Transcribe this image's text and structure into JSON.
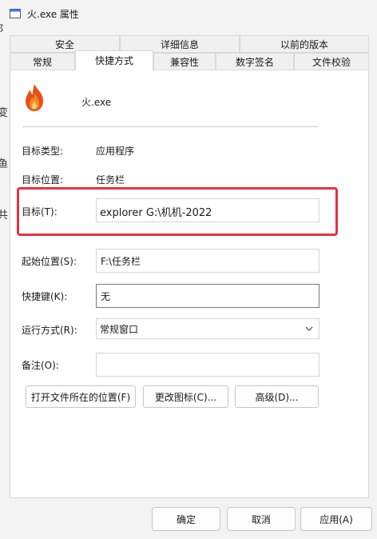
{
  "window": {
    "title": "火.exe 属性"
  },
  "tabs_back": [
    "安全",
    "详细信息",
    "以前的版本"
  ],
  "tabs_front": [
    "常规",
    "快捷方式",
    "兼容性",
    "数字签名",
    "文件校验"
  ],
  "active_tab": "快捷方式",
  "shortcut": {
    "name": "火.exe",
    "target_type_label": "目标类型:",
    "target_type_value": "应用程序",
    "target_location_label": "目标位置:",
    "target_location_value": "任务栏",
    "target_label": "目标(T):",
    "target_value": "explorer G:\\机机-2022",
    "start_in_label": "起始位置(S):",
    "start_in_value": "F:\\任务栏",
    "hotkey_label": "快捷键(K):",
    "hotkey_value": "无",
    "run_label": "运行方式(R):",
    "run_value": "常规窗口",
    "comment_label": "备注(O):",
    "comment_value": ""
  },
  "buttons": {
    "open_location": "打开文件所在的位置(F)",
    "change_icon": "更改图标(C)...",
    "advanced": "高级(D)..."
  },
  "footer": {
    "ok": "确定",
    "cancel": "取消",
    "apply": "应用(A)"
  },
  "bleed_chars": [
    "阝",
    "变",
    "鱼",
    "共"
  ],
  "colors": {
    "highlight": "#e4343f",
    "flame": "#e8501a"
  }
}
